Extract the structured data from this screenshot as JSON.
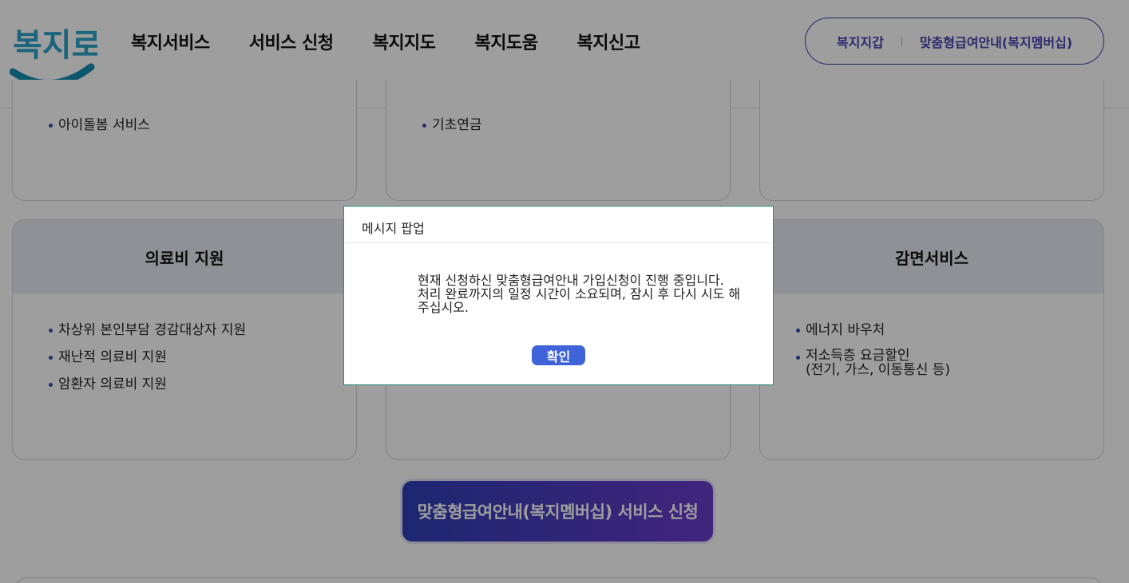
{
  "header": {
    "logo_text": "복지로",
    "nav": [
      "복지서비스",
      "서비스 신청",
      "복지지도",
      "복지도움",
      "복지신고"
    ],
    "pill_links": [
      "복지지갑",
      "맞춤형급여안내(복지멤버십)"
    ]
  },
  "cards_top": [
    {
      "items": [
        "아이돌봄 서비스"
      ]
    },
    {
      "items": [
        "기초연금"
      ]
    },
    {
      "items": []
    }
  ],
  "cards_main": [
    {
      "title": "의료비 지원",
      "items": [
        "차상위 본인부담 경감대상자 지원",
        "재난적 의료비 지원",
        "암환자 의료비 지원"
      ]
    },
    {
      "title": "",
      "items": []
    },
    {
      "title": "감면서비스",
      "items": [
        "에너지 바우처",
        "저소득층 요금할인"
      ],
      "item_sub": "(전기, 가스, 이동통신 등)"
    }
  ],
  "cta_label": "맞춤형급여안내(복지멤버십) 서비스 신청",
  "modal": {
    "title": "메시지 팝업",
    "lines": [
      "현재 신청하신 맞춤형급여안내 가입신청이 진행 중입니다.",
      "처리 완료까지의 일정 시간이 소요되며, 잠시 후 다시 시도 해",
      "주십시오."
    ],
    "confirm": "확인"
  },
  "colors": {
    "brand_blue": "#3b3bb0",
    "modal_border": "#2a8f84",
    "confirm_bg": "#3f63d9",
    "cta_start": "#2f3fb6",
    "cta_end": "#6a3cc9"
  }
}
